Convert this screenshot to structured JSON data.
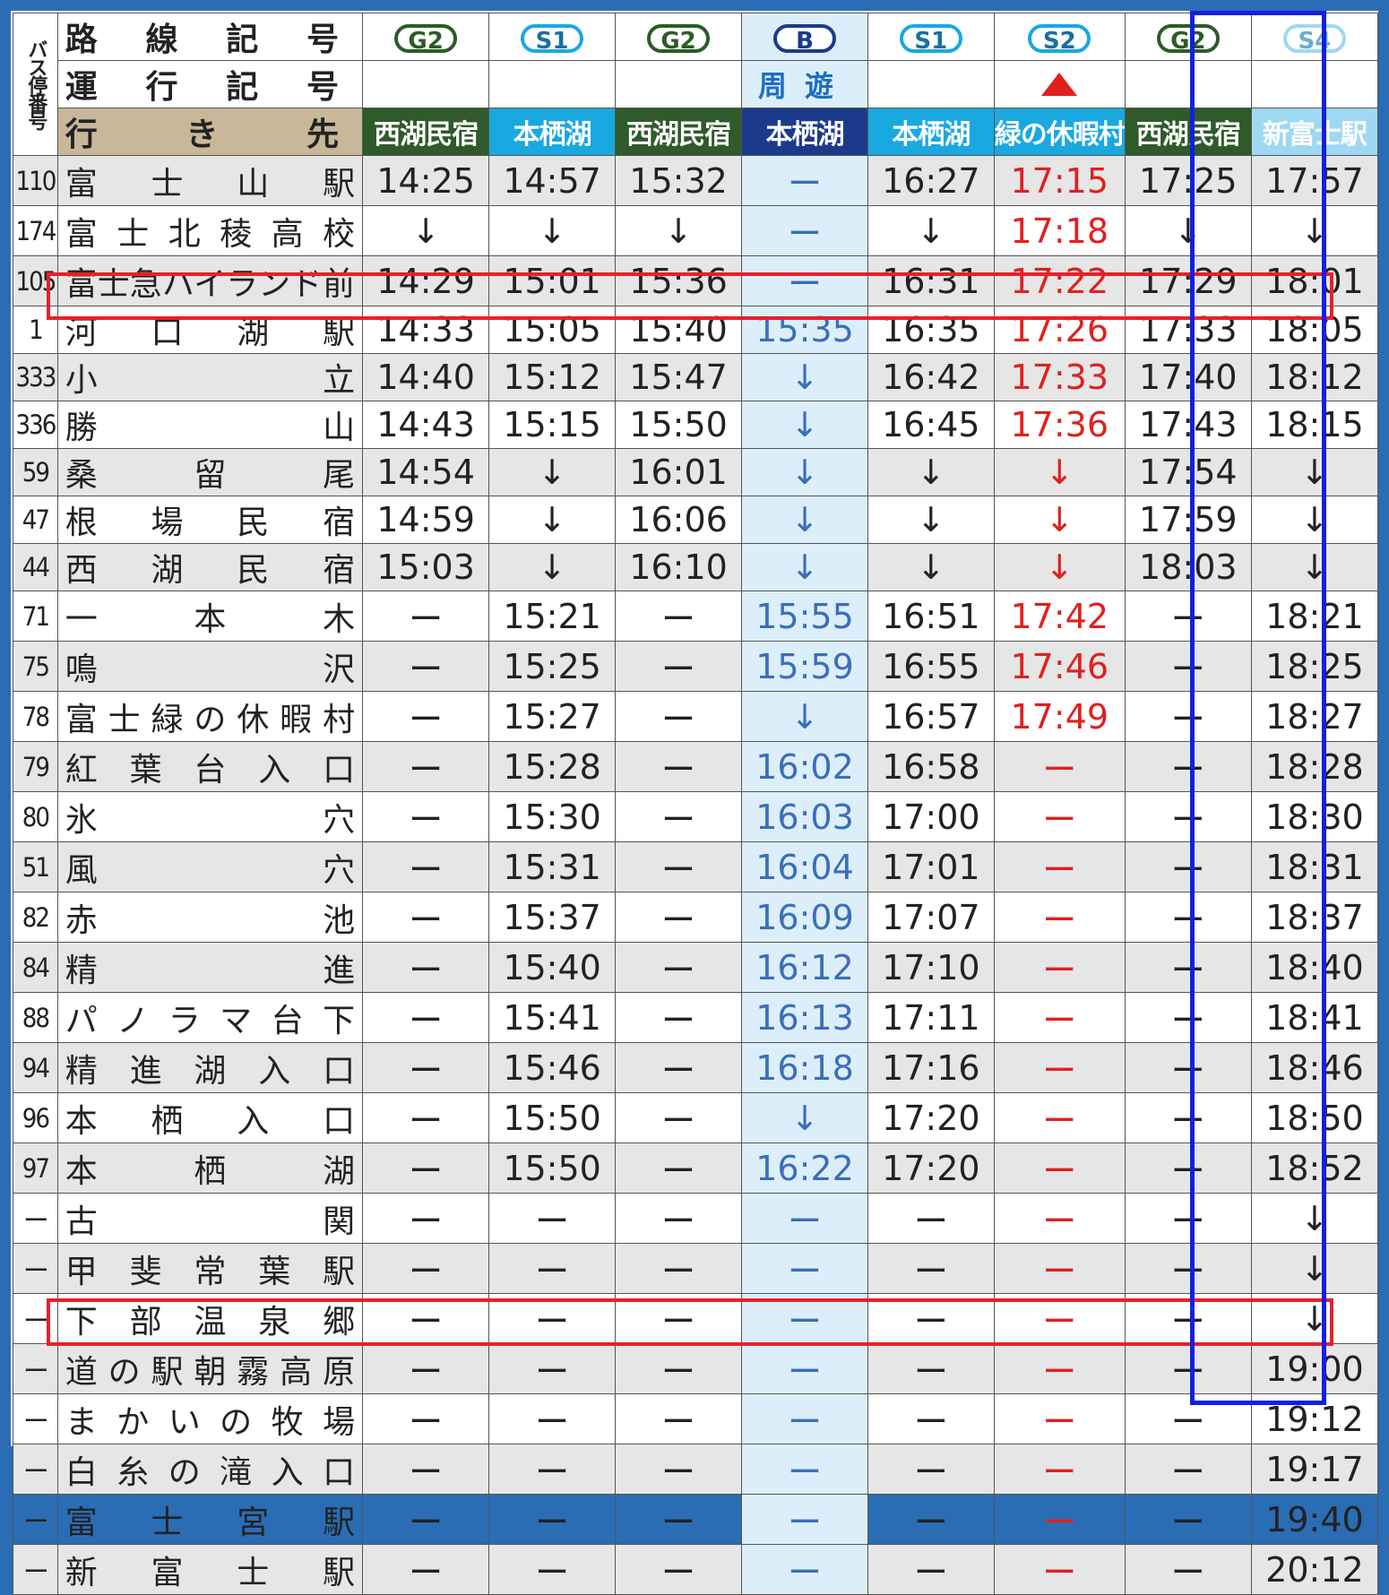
{
  "header": {
    "stop_number_label": "バス停番号",
    "route_code_label": "路線記号",
    "service_code_label": "運行記号",
    "destination_label": "行き先"
  },
  "columns": [
    {
      "route": "G2",
      "service": "",
      "destination": "西湖民宿",
      "dest_color": "#2f5a2a",
      "badge_class": "bG",
      "text_class": ""
    },
    {
      "route": "S1",
      "service": "",
      "destination": "本栖湖",
      "dest_color": "#1aa8e0",
      "badge_class": "bS",
      "text_class": ""
    },
    {
      "route": "G2",
      "service": "",
      "destination": "西湖民宿",
      "dest_color": "#2f5a2a",
      "badge_class": "bG",
      "text_class": ""
    },
    {
      "route": "B",
      "service": "周遊",
      "destination": "本栖湖",
      "dest_color": "#1c3a8c",
      "badge_class": "bB",
      "text_class": "blue"
    },
    {
      "route": "S1",
      "service": "",
      "destination": "本栖湖",
      "dest_color": "#1aa8e0",
      "badge_class": "bS",
      "text_class": ""
    },
    {
      "route": "S2",
      "service": "▲",
      "destination": "緑の休暇村",
      "dest_color": "#1aa8e0",
      "badge_class": "bS",
      "text_class": "red"
    },
    {
      "route": "G2",
      "service": "",
      "destination": "西湖民宿",
      "dest_color": "#2f5a2a",
      "badge_class": "bG",
      "text_class": ""
    },
    {
      "route": "S4",
      "service": "",
      "destination": "新富士駅",
      "dest_color": "#9fd8f2",
      "badge_class": "bS4",
      "text_class": ""
    }
  ],
  "rows": [
    {
      "no": "110",
      "name": "富士山駅",
      "times": [
        "14:25",
        "14:57",
        "15:32",
        "ー",
        "16:27",
        "17:15",
        "17:25",
        "17:57"
      ]
    },
    {
      "no": "174",
      "name": "富士北稜高校",
      "times": [
        "↓",
        "↓",
        "↓",
        "ー",
        "↓",
        "17:18",
        "↓",
        "↓"
      ]
    },
    {
      "no": "105",
      "name": "富士急ハイランド前",
      "times": [
        "14:29",
        "15:01",
        "15:36",
        "ー",
        "16:31",
        "17:22",
        "17:29",
        "18:01"
      ]
    },
    {
      "no": "1",
      "name": "河口湖駅",
      "times": [
        "14:33",
        "15:05",
        "15:40",
        "15:35",
        "16:35",
        "17:26",
        "17:33",
        "18:05"
      ]
    },
    {
      "no": "333",
      "name": "小立",
      "times": [
        "14:40",
        "15:12",
        "15:47",
        "↓",
        "16:42",
        "17:33",
        "17:40",
        "18:12"
      ]
    },
    {
      "no": "336",
      "name": "勝山",
      "times": [
        "14:43",
        "15:15",
        "15:50",
        "↓",
        "16:45",
        "17:36",
        "17:43",
        "18:15"
      ]
    },
    {
      "no": "59",
      "name": "桑留尾",
      "times": [
        "14:54",
        "↓",
        "16:01",
        "↓",
        "↓",
        "↓",
        "17:54",
        "↓"
      ]
    },
    {
      "no": "47",
      "name": "根場民宿",
      "times": [
        "14:59",
        "↓",
        "16:06",
        "↓",
        "↓",
        "↓",
        "17:59",
        "↓"
      ]
    },
    {
      "no": "44",
      "name": "西湖民宿",
      "times": [
        "15:03",
        "↓",
        "16:10",
        "↓",
        "↓",
        "↓",
        "18:03",
        "↓"
      ]
    },
    {
      "no": "71",
      "name": "一本木",
      "times": [
        "ー",
        "15:21",
        "ー",
        "15:55",
        "16:51",
        "17:42",
        "ー",
        "18:21"
      ]
    },
    {
      "no": "75",
      "name": "鳴沢",
      "times": [
        "ー",
        "15:25",
        "ー",
        "15:59",
        "16:55",
        "17:46",
        "ー",
        "18:25"
      ]
    },
    {
      "no": "78",
      "name": "富士緑の休暇村",
      "times": [
        "ー",
        "15:27",
        "ー",
        "↓",
        "16:57",
        "17:49",
        "ー",
        "18:27"
      ]
    },
    {
      "no": "79",
      "name": "紅葉台入口",
      "times": [
        "ー",
        "15:28",
        "ー",
        "16:02",
        "16:58",
        "ー",
        "ー",
        "18:28"
      ]
    },
    {
      "no": "80",
      "name": "氷穴",
      "times": [
        "ー",
        "15:30",
        "ー",
        "16:03",
        "17:00",
        "ー",
        "ー",
        "18:30"
      ]
    },
    {
      "no": "51",
      "name": "風穴",
      "times": [
        "ー",
        "15:31",
        "ー",
        "16:04",
        "17:01",
        "ー",
        "ー",
        "18:31"
      ]
    },
    {
      "no": "82",
      "name": "赤池",
      "times": [
        "ー",
        "15:37",
        "ー",
        "16:09",
        "17:07",
        "ー",
        "ー",
        "18:37"
      ]
    },
    {
      "no": "84",
      "name": "精進",
      "times": [
        "ー",
        "15:40",
        "ー",
        "16:12",
        "17:10",
        "ー",
        "ー",
        "18:40"
      ]
    },
    {
      "no": "88",
      "name": "パノラマ台下",
      "times": [
        "ー",
        "15:41",
        "ー",
        "16:13",
        "17:11",
        "ー",
        "ー",
        "18:41"
      ]
    },
    {
      "no": "94",
      "name": "精進湖入口",
      "times": [
        "ー",
        "15:46",
        "ー",
        "16:18",
        "17:16",
        "ー",
        "ー",
        "18:46"
      ]
    },
    {
      "no": "96",
      "name": "本栖入口",
      "times": [
        "ー",
        "15:50",
        "ー",
        "↓",
        "17:20",
        "ー",
        "ー",
        "18:50"
      ]
    },
    {
      "no": "97",
      "name": "本栖湖",
      "times": [
        "ー",
        "15:50",
        "ー",
        "16:22",
        "17:20",
        "ー",
        "ー",
        "18:52"
      ]
    },
    {
      "no": "ー",
      "name": "古関",
      "times": [
        "ー",
        "ー",
        "ー",
        "ー",
        "ー",
        "ー",
        "ー",
        "↓"
      ]
    },
    {
      "no": "ー",
      "name": "甲斐常葉駅",
      "times": [
        "ー",
        "ー",
        "ー",
        "ー",
        "ー",
        "ー",
        "ー",
        "↓"
      ]
    },
    {
      "no": "ー",
      "name": "下部温泉郷",
      "times": [
        "ー",
        "ー",
        "ー",
        "ー",
        "ー",
        "ー",
        "ー",
        "↓"
      ]
    },
    {
      "no": "ー",
      "name": "道の駅朝霧高原",
      "times": [
        "ー",
        "ー",
        "ー",
        "ー",
        "ー",
        "ー",
        "ー",
        "19:00"
      ]
    },
    {
      "no": "ー",
      "name": "まかいの牧場",
      "times": [
        "ー",
        "ー",
        "ー",
        "ー",
        "ー",
        "ー",
        "ー",
        "19:12"
      ]
    },
    {
      "no": "ー",
      "name": "白糸の滝入口",
      "times": [
        "ー",
        "ー",
        "ー",
        "ー",
        "ー",
        "ー",
        "ー",
        "19:17"
      ]
    },
    {
      "no": "ー",
      "name": "富士宮駅",
      "times": [
        "ー",
        "ー",
        "ー",
        "ー",
        "ー",
        "ー",
        "ー",
        "19:40"
      ]
    },
    {
      "no": "ー",
      "name": "新富士駅",
      "times": [
        "ー",
        "ー",
        "ー",
        "ー",
        "ー",
        "ー",
        "ー",
        "20:12"
      ]
    }
  ]
}
